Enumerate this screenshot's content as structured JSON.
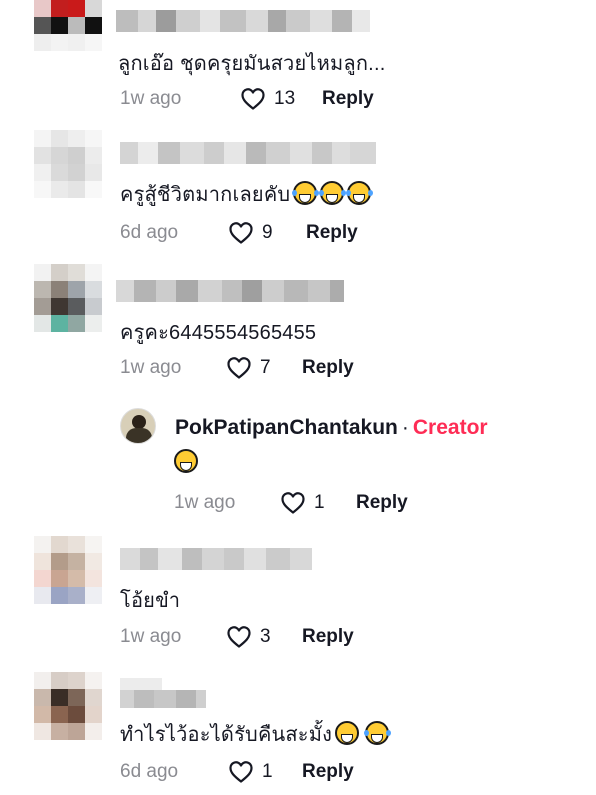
{
  "comments": [
    {
      "text": "ลูกเอ๊อ ชุดครุยมันสวยไหมลูก...",
      "time": "1w ago",
      "likes": "13",
      "reply": "Reply"
    },
    {
      "text": "ครูสู้ชีวิตมากเลยคับ",
      "time": "6d ago",
      "likes": "9",
      "reply": "Reply"
    },
    {
      "text": "ครูคะ6445554565455",
      "time": "1w ago",
      "likes": "7",
      "reply": "Reply"
    },
    {
      "text": "โอ้ยขำ",
      "time": "1w ago",
      "likes": "3",
      "reply": "Reply"
    },
    {
      "text": "ทำไรไว้อะได้รับคืนสะมั้ง",
      "time": "6d ago",
      "likes": "1",
      "reply": "Reply"
    }
  ],
  "creator_reply": {
    "name": "PokPatipanChantakun",
    "separator": "·",
    "badge": "Creator",
    "time": "1w ago",
    "likes": "1",
    "reply": "Reply"
  },
  "colors": {
    "creator_badge": "#fe2c55",
    "secondary_text": "#8a8b91"
  },
  "icons": [
    "heart-outline-icon",
    "grinning-emoji-icon",
    "tears-of-joy-emoji-icon"
  ]
}
